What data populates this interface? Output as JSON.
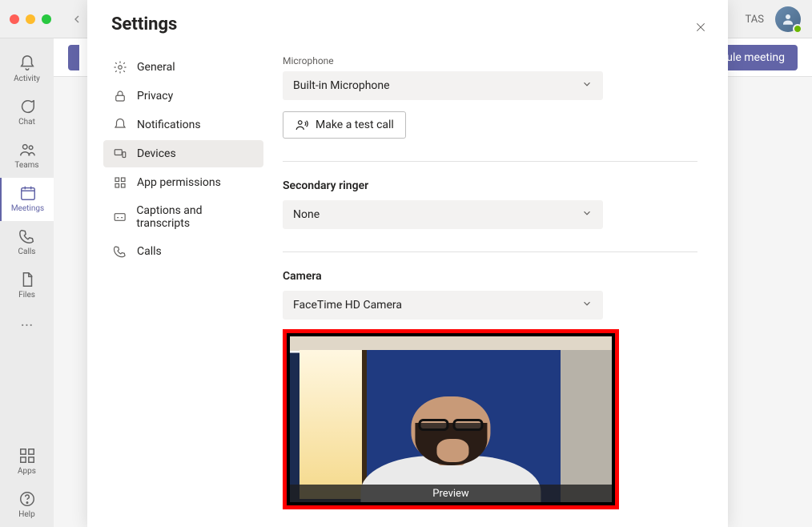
{
  "titlebar": {
    "user_initials": "TAS"
  },
  "rail": [
    {
      "key": "activity",
      "label": "Activity"
    },
    {
      "key": "chat",
      "label": "Chat"
    },
    {
      "key": "teams",
      "label": "Teams"
    },
    {
      "key": "meetings",
      "label": "Meetings"
    },
    {
      "key": "calls",
      "label": "Calls"
    },
    {
      "key": "files",
      "label": "Files"
    }
  ],
  "rail_bottom": [
    {
      "key": "apps",
      "label": "Apps"
    },
    {
      "key": "help",
      "label": "Help"
    }
  ],
  "toolbar": {
    "schedule_meeting_label": "Schedule meeting"
  },
  "modal": {
    "title": "Settings"
  },
  "settings_nav": [
    {
      "key": "general",
      "label": "General"
    },
    {
      "key": "privacy",
      "label": "Privacy"
    },
    {
      "key": "notifications",
      "label": "Notifications"
    },
    {
      "key": "devices",
      "label": "Devices"
    },
    {
      "key": "app_permissions",
      "label": "App permissions"
    },
    {
      "key": "captions",
      "label": "Captions and transcripts"
    },
    {
      "key": "calls",
      "label": "Calls"
    }
  ],
  "devices": {
    "microphone": {
      "label": "Microphone",
      "value": "Built-in Microphone",
      "test_call_label": "Make a test call"
    },
    "secondary_ringer": {
      "label": "Secondary ringer",
      "value": "None"
    },
    "camera": {
      "label": "Camera",
      "value": "FaceTime HD Camera",
      "preview_label": "Preview"
    }
  },
  "colors": {
    "accent": "#6264a7",
    "highlight_border": "#ff0000"
  }
}
